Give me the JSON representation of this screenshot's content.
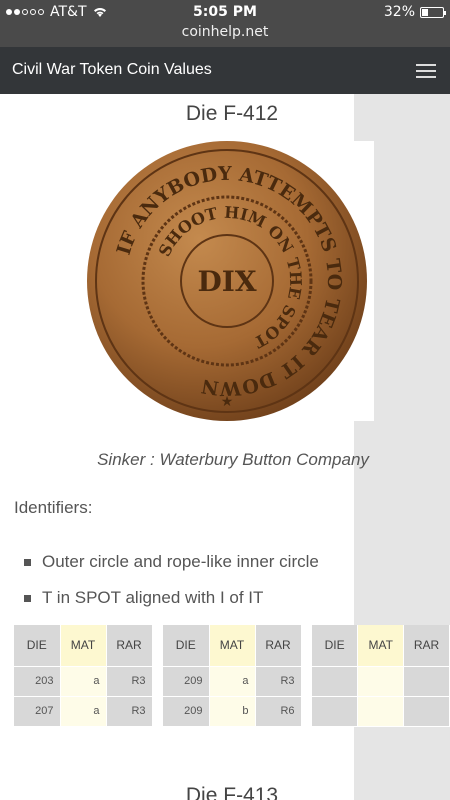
{
  "status": {
    "carrier": "AT&T",
    "time": "5:05 PM",
    "battery": "32%",
    "battery_level": 0.32
  },
  "browser": {
    "url": "coinhelp.net"
  },
  "header": {
    "title": "Civil War Token Coin Values"
  },
  "die": {
    "title": "Die F-412",
    "coin": {
      "outer_text": "IF ANYBODY ATTEMPTS TO TEAR IT DOWN",
      "inner_text": "SHOOT HIM ON THE SPOT",
      "center_text": "DIX"
    },
    "caption": "Sinker : Waterbury Button Company",
    "identifiers_label": "Identifiers:",
    "identifiers": [
      "Outer circle and rope-like inner circle",
      "T in SPOT aligned with I of IT"
    ],
    "table_headers": [
      "DIE",
      "MAT",
      "RAR"
    ],
    "tables": [
      {
        "rows": [
          [
            "203",
            "a",
            "R3"
          ],
          [
            "207",
            "a",
            "R3"
          ]
        ]
      },
      {
        "rows": [
          [
            "209",
            "a",
            "R3"
          ],
          [
            "209",
            "b",
            "R6"
          ]
        ]
      },
      {
        "rows": [
          [
            "",
            "",
            ""
          ],
          [
            "",
            "",
            ""
          ]
        ]
      }
    ]
  },
  "next_die": {
    "title": "Die F-413"
  }
}
